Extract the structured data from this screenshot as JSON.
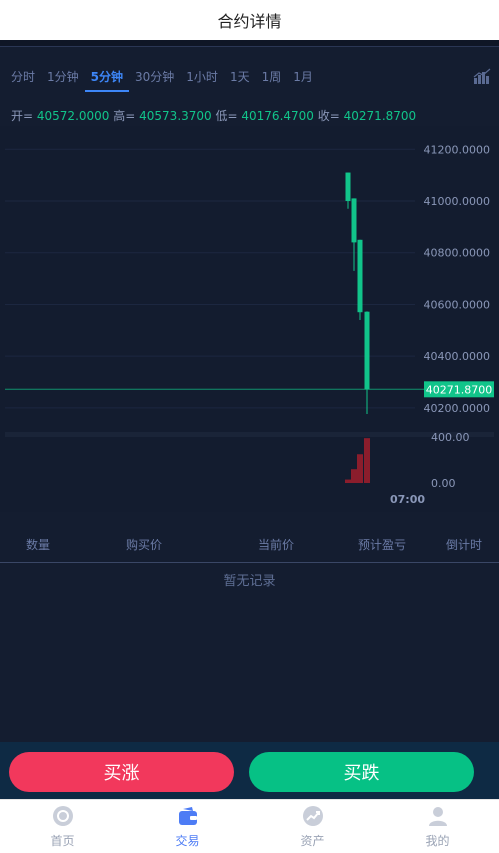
{
  "header": {
    "title": "合约详情"
  },
  "timeframes": [
    {
      "label": "分时",
      "active": false
    },
    {
      "label": "1分钟",
      "active": false
    },
    {
      "label": "5分钟",
      "active": true
    },
    {
      "label": "30分钟",
      "active": false
    },
    {
      "label": "1小时",
      "active": false
    },
    {
      "label": "1天",
      "active": false
    },
    {
      "label": "1周",
      "active": false
    },
    {
      "label": "1月",
      "active": false
    }
  ],
  "ohlc": {
    "open_label": "开=",
    "open": "40572.0000",
    "high_label": "高=",
    "high": "40573.3700",
    "low_label": "低=",
    "low": "40176.4700",
    "close_label": "收=",
    "close": "40271.8700"
  },
  "chart_data": {
    "type": "candlestick",
    "y_ticks": [
      "41200.0000",
      "41000.0000",
      "40800.0000",
      "40600.0000",
      "40400.0000",
      "40200.0000"
    ],
    "ylim": [
      40130,
      41290
    ],
    "current_price": "40271.8700",
    "candles": [
      {
        "open": 41110,
        "close": 41000,
        "high": 41110,
        "low": 40970
      },
      {
        "open": 41010,
        "close": 40840,
        "high": 41010,
        "low": 40730
      },
      {
        "open": 40850,
        "close": 40570,
        "high": 40850,
        "low": 40540
      },
      {
        "open": 40572.0,
        "close": 40271.87,
        "high": 40573.37,
        "low": 40176.47
      }
    ],
    "volume_ticks": [
      "400.00",
      "0.00"
    ],
    "volumes": [
      30,
      120,
      250,
      390
    ],
    "volume_max": 400,
    "x_labels": [
      "07:00"
    ],
    "colors": {
      "up": "#11c48a",
      "down": "#8b1d2c",
      "price_line": "#11c48a",
      "grid": "#1c2740"
    }
  },
  "table": {
    "columns": [
      "数量",
      "购买价",
      "当前价",
      "预计盈亏",
      "倒计时"
    ],
    "empty_text": "暂无记录"
  },
  "actions": {
    "buy_up": "买涨",
    "buy_down": "买跌"
  },
  "tabbar": [
    {
      "label": "首页",
      "icon": "home-icon",
      "active": false
    },
    {
      "label": "交易",
      "icon": "wallet-icon",
      "active": true
    },
    {
      "label": "资产",
      "icon": "chart-up-icon",
      "active": false
    },
    {
      "label": "我的",
      "icon": "user-icon",
      "active": false
    }
  ]
}
